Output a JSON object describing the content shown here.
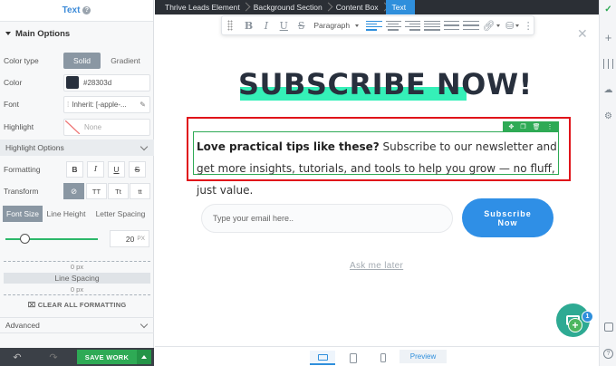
{
  "panel": {
    "title": "Text",
    "help": "?",
    "main_options": "Main Options",
    "color_type": {
      "label": "Color type",
      "options": [
        "Solid",
        "Gradient"
      ],
      "selected": "Solid"
    },
    "color": {
      "label": "Color",
      "value": "#28303d"
    },
    "font": {
      "label": "Font",
      "value": "Inherit: [-apple-..."
    },
    "highlight": {
      "label": "Highlight",
      "value": "None"
    },
    "highlight_options": "Highlight Options",
    "formatting": {
      "label": "Formatting",
      "buttons": [
        "B",
        "I",
        "U",
        "S"
      ]
    },
    "transform": {
      "label": "Transform",
      "buttons": [
        "⊘",
        "TT",
        "Tt",
        "tt"
      ]
    },
    "size_tabs": [
      "Font Size",
      "Line Height",
      "Letter Spacing"
    ],
    "font_size": {
      "value": "20",
      "unit": "PX",
      "level": 0.2
    },
    "spacing": {
      "top": "0 px",
      "label": "Line Spacing",
      "bottom": "0 px"
    },
    "clear_formatting": "CLEAR ALL FORMATTING",
    "advanced": "Advanced",
    "save": "SAVE WORK"
  },
  "breadcrumb": [
    "Thrive Leads Element",
    "Background Section",
    "Content Box",
    "Text"
  ],
  "toolbar": {
    "paragraph": "Paragraph"
  },
  "content": {
    "headline": "SUBSCRIBE NOW!",
    "paragraph_bold": "Love practical tips like these?",
    "paragraph_rest": " Subscribe to our newsletter and get more insights, tutorials, and tools to help you grow — no fluff, just value.",
    "email_placeholder": "Type your email here..",
    "subscribe_line1": "Subscribe",
    "subscribe_line2": "Now",
    "ask_later": "Ask me later"
  },
  "device_bar": {
    "preview": "Preview"
  },
  "fab": {
    "badge": "1"
  },
  "colors": {
    "accent": "#2f8fdc",
    "highlight_bar": "#35f0b8",
    "select_outline": "#e0141a",
    "save_green": "#2eaa55",
    "headline": "#28303d"
  }
}
